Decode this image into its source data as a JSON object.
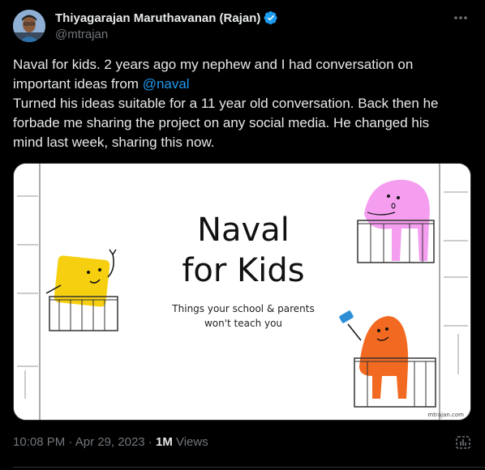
{
  "author": {
    "name": "Thiyagarajan Maruthavanan (Rajan)",
    "handle": "@mtrajan",
    "verified": true
  },
  "tweet": {
    "line1": "Naval for kids. 2 years ago my nephew and I had conversation on",
    "line2_prefix": "important ideas from ",
    "mention": "@naval",
    "line3": "Turned his ideas suitable for a 11 year old conversation.  Back then he",
    "line4": "forbade me sharing the project on any social media. He changed his",
    "line5": "mind last week, sharing this now."
  },
  "media": {
    "title_line1": "Naval",
    "title_line2": "for Kids",
    "subtitle_line1": "Things your school & parents",
    "subtitle_line2": "won't teach you",
    "watermark": "mtrajan.com",
    "colors": {
      "yellow": "#f6d010",
      "pink": "#f59ef0",
      "orange": "#f26a21",
      "blue": "#2c8fd6"
    }
  },
  "meta": {
    "time": "10:08 PM",
    "separator1": " · ",
    "date": "Apr 29, 2023",
    "separator2": " · ",
    "views_count": "1M",
    "views_label": " Views"
  },
  "icons": {
    "more": "more-icon",
    "verified": "verified-badge-icon",
    "analytics": "analytics-icon"
  },
  "colors": {
    "background": "#000000",
    "text": "#e7e9ea",
    "muted": "#71767b",
    "link": "#1d9bf0"
  }
}
